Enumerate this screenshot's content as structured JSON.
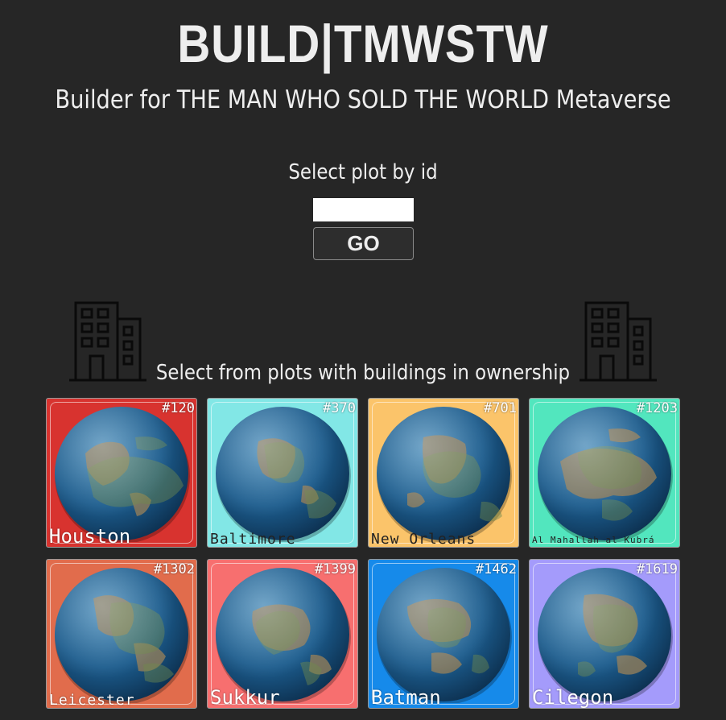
{
  "header": {
    "title": "BUILD|TMWSTW",
    "subtitle": "Builder for THE MAN WHO SOLD THE WORLD Metaverse"
  },
  "plot_search": {
    "label": "Select plot by id",
    "input_value": "",
    "go_label": "GO"
  },
  "owned": {
    "label": "Select from plots with buildings in ownership",
    "icon": "building-icon",
    "plots": [
      {
        "id": "#120",
        "city": "Houston",
        "color": "#d8332f",
        "size": "big",
        "dark": false
      },
      {
        "id": "#370",
        "city": "Baltimore",
        "color": "#82e7e6",
        "size": "mid",
        "dark": true
      },
      {
        "id": "#701",
        "city": "New Orleans",
        "color": "#fbc46a",
        "size": "mid",
        "dark": true
      },
      {
        "id": "#1203",
        "city": "Al Mahallah al Kubrá",
        "color": "#52e6be",
        "size": "small",
        "dark": true
      },
      {
        "id": "#1302",
        "city": "Leicester",
        "color": "#e16c4c",
        "size": "mid",
        "dark": false
      },
      {
        "id": "#1399",
        "city": "Sukkur",
        "color": "#f76f6f",
        "size": "big",
        "dark": false
      },
      {
        "id": "#1462",
        "city": "Batman",
        "color": "#168aea",
        "size": "big",
        "dark": false
      },
      {
        "id": "#1619",
        "city": "Cilegon",
        "color": "#a49bfb",
        "size": "big",
        "dark": false
      }
    ]
  }
}
